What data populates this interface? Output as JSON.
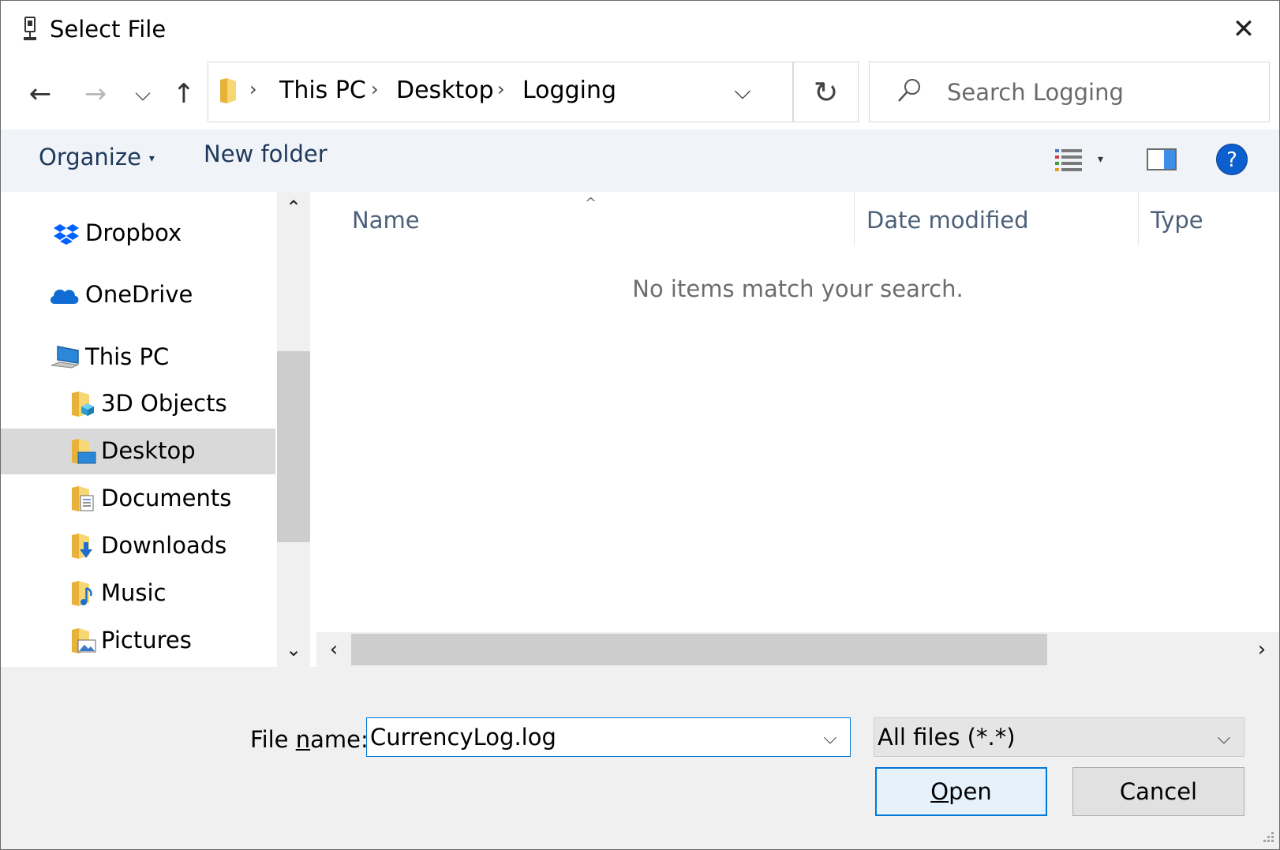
{
  "window": {
    "title": "Select File",
    "close_glyph": "✕"
  },
  "nav": {
    "back_glyph": "←",
    "forward_glyph": "→",
    "recent_glyph": "⌵",
    "up_glyph": "↑",
    "refresh_glyph": "↻",
    "breadcrumb": [
      "This PC",
      "Desktop",
      "Logging"
    ],
    "breadcrumb_sep": "›",
    "address_dropdown_glyph": "⌵"
  },
  "search": {
    "placeholder": "Search Logging",
    "value": ""
  },
  "toolbar": {
    "organize_label": "Organize",
    "new_folder_label": "New folder",
    "view_dropdown_glyph": "▾",
    "help_glyph": "?"
  },
  "sidebar": {
    "items": [
      {
        "label": "Dropbox",
        "icon": "dropbox-icon",
        "selected": false
      },
      {
        "label": "OneDrive",
        "icon": "onedrive-icon",
        "selected": false
      },
      {
        "label": "This PC",
        "icon": "computer-icon",
        "selected": false
      },
      {
        "label": "3D Objects",
        "icon": "3d-objects-folder-icon",
        "selected": false
      },
      {
        "label": "Desktop",
        "icon": "desktop-folder-icon",
        "selected": true
      },
      {
        "label": "Documents",
        "icon": "documents-folder-icon",
        "selected": false
      },
      {
        "label": "Downloads",
        "icon": "downloads-folder-icon",
        "selected": false
      },
      {
        "label": "Music",
        "icon": "music-folder-icon",
        "selected": false
      },
      {
        "label": "Pictures",
        "icon": "pictures-folder-icon",
        "selected": false
      }
    ],
    "scroll_up_glyph": "⌃",
    "scroll_down_glyph": "⌄"
  },
  "filelist": {
    "columns": [
      "Name",
      "Date modified",
      "Type"
    ],
    "sort_glyph": "^",
    "empty_message": "No items match your search.",
    "scroll_left_glyph": "‹",
    "scroll_right_glyph": "›"
  },
  "footer": {
    "filename_label_prefix": "File ",
    "filename_label_accel": "n",
    "filename_label_suffix": "ame:",
    "filename_value": "CurrencyLog.log",
    "filename_dropdown_glyph": "⌵",
    "filter_value": "All files (*.*)",
    "filter_dropdown_glyph": "⌵",
    "open_accel": "O",
    "open_rest": "pen",
    "cancel_label": "Cancel"
  },
  "colors": {
    "accent": "#0078d7",
    "command_text": "#1e395b",
    "selected_row": "#d9d9d9",
    "help_blue": "#0c5fcf"
  }
}
